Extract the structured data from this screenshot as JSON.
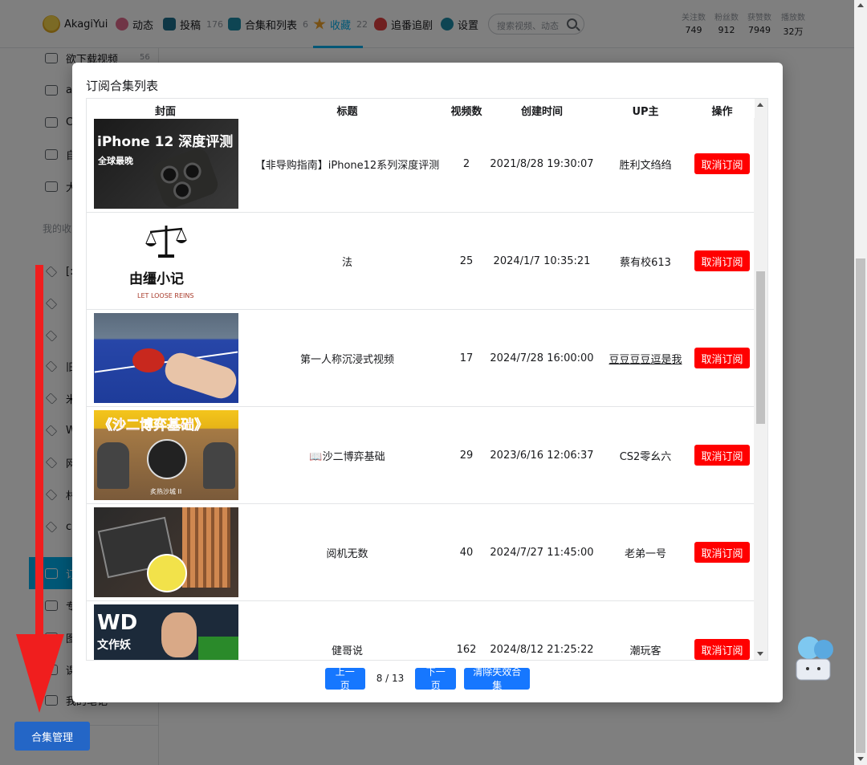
{
  "nav": {
    "username": "AkagiYui",
    "items": [
      {
        "label": "动态",
        "count": ""
      },
      {
        "label": "投稿",
        "count": "176"
      },
      {
        "label": "合集和列表",
        "count": "6"
      },
      {
        "label": "收藏",
        "count": "22"
      },
      {
        "label": "追番追剧",
        "count": ""
      },
      {
        "label": "设置",
        "count": ""
      }
    ],
    "search_placeholder": "搜索视频、动态",
    "stats": [
      {
        "label": "关注数",
        "value": "749"
      },
      {
        "label": "粉丝数",
        "value": "912"
      },
      {
        "label": "获赞数",
        "value": "7949"
      },
      {
        "label": "播放数",
        "value": "32万"
      }
    ]
  },
  "sidebar": {
    "items": [
      {
        "label": "欲下载视频",
        "count": "56"
      },
      {
        "label": "a",
        "count": ""
      },
      {
        "label": "C",
        "count": ""
      },
      {
        "label": "自",
        "count": ""
      },
      {
        "label": "大",
        "count": ""
      }
    ],
    "section_label": "我的收",
    "sub_items": [
      {
        "label": "[:"
      },
      {
        "label": ""
      },
      {
        "label": ""
      },
      {
        "label": "旧"
      },
      {
        "label": "米"
      },
      {
        "label": "W"
      },
      {
        "label": "网"
      },
      {
        "label": "村"
      },
      {
        "label": "c"
      },
      {
        "label": "订"
      },
      {
        "label": "专"
      },
      {
        "label": "图"
      },
      {
        "label": "课"
      },
      {
        "label": "我的笔记"
      }
    ]
  },
  "manage_button": "合集管理",
  "modal": {
    "title": "订阅合集列表",
    "columns": [
      "封面",
      "标题",
      "视频数",
      "创建时间",
      "UP主",
      "操作"
    ],
    "rows": [
      {
        "title": "【非导购指南】iPhone12系列深度评测",
        "count": "2",
        "created": "2021/8/28 19:30:07",
        "up": "胜利文绉绉",
        "action": "取消订阅",
        "cover_text": "iPhone 12 深度评测",
        "cover_sub": "全球最晚"
      },
      {
        "title": "法",
        "count": "25",
        "created": "2024/1/7 10:35:21",
        "up": "蔡有校613",
        "action": "取消订阅",
        "cover_text": "由缰小记",
        "cover_sub": "LET LOOSE REINS"
      },
      {
        "title": "第一人称沉浸式视频",
        "count": "17",
        "created": "2024/7/28 16:00:00",
        "up": "豆豆豆豆逗是我",
        "action": "取消订阅",
        "cover_text": "",
        "cover_sub": ""
      },
      {
        "title": "📖沙二博弈基础",
        "count": "29",
        "created": "2023/6/16 12:06:37",
        "up": "CS2零幺六",
        "action": "取消订阅",
        "cover_text": "《沙二博弈基础》",
        "cover_sub": "炙热沙城 II"
      },
      {
        "title": "阅机无数",
        "count": "40",
        "created": "2024/7/27 11:45:00",
        "up": "老弟一号",
        "action": "取消订阅",
        "cover_text": "",
        "cover_sub": ""
      },
      {
        "title": "健哥说",
        "count": "162",
        "created": "2024/8/12 21:25:22",
        "up": "潮玩客",
        "action": "取消订阅",
        "cover_text": "WD",
        "cover_sub": "文作妖"
      }
    ],
    "pager": {
      "prev": "上一页",
      "info": "8 / 13",
      "next": "下一页",
      "clear": "清除失效合集"
    }
  },
  "colors": {
    "accent": "#00aeec",
    "danger": "#ff0000",
    "primary": "#1677ff",
    "manage": "#2466c6"
  }
}
